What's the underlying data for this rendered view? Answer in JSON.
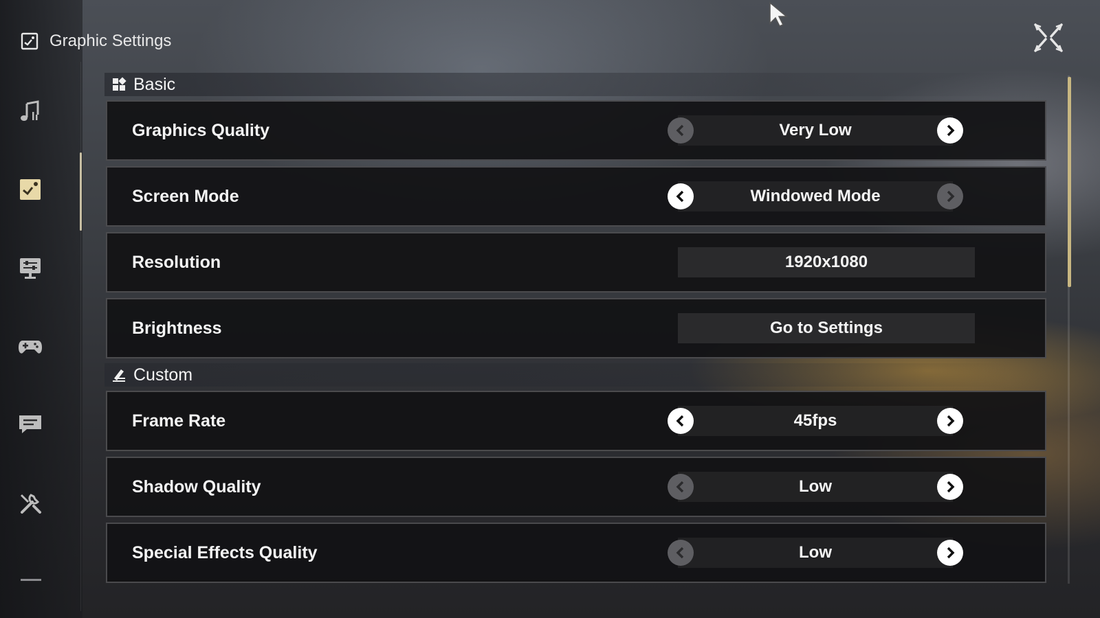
{
  "header": {
    "title": "Graphic Settings",
    "icon": "image-settings-icon"
  },
  "sidebar": {
    "items": [
      {
        "id": "audio",
        "icon": "music-note-icon",
        "active": false
      },
      {
        "id": "graphics",
        "icon": "image-settings-icon",
        "active": true
      },
      {
        "id": "display",
        "icon": "monitor-sliders-icon",
        "active": false
      },
      {
        "id": "controls",
        "icon": "gamepad-icon",
        "active": false
      },
      {
        "id": "chat",
        "icon": "chat-bubble-icon",
        "active": false
      },
      {
        "id": "tools",
        "icon": "tools-icon",
        "active": false
      }
    ]
  },
  "sections": {
    "basic": {
      "title": "Basic",
      "icon": "grid-icon",
      "rows": [
        {
          "label": "Graphics Quality",
          "value": "Very Low",
          "left_enabled": false,
          "right_enabled": true
        },
        {
          "label": "Screen Mode",
          "value": "Windowed Mode",
          "left_enabled": true,
          "right_enabled": false
        },
        {
          "label": "Resolution",
          "value": "1920x1080"
        },
        {
          "label": "Brightness",
          "value": "Go to Settings"
        }
      ]
    },
    "custom": {
      "title": "Custom",
      "icon": "pen-edit-icon",
      "rows": [
        {
          "label": "Frame Rate",
          "value": "45fps",
          "left_enabled": true,
          "right_enabled": true
        },
        {
          "label": "Shadow Quality",
          "value": "Low",
          "left_enabled": false,
          "right_enabled": true
        },
        {
          "label": "Special Effects Quality",
          "value": "Low",
          "left_enabled": false,
          "right_enabled": true
        }
      ]
    }
  },
  "colors": {
    "accent": "#c8b782",
    "active_icon": "#e8d9a8",
    "arrow_enabled": "#ffffff",
    "arrow_disabled": "#5e5e62",
    "row_bg": "#121214"
  }
}
